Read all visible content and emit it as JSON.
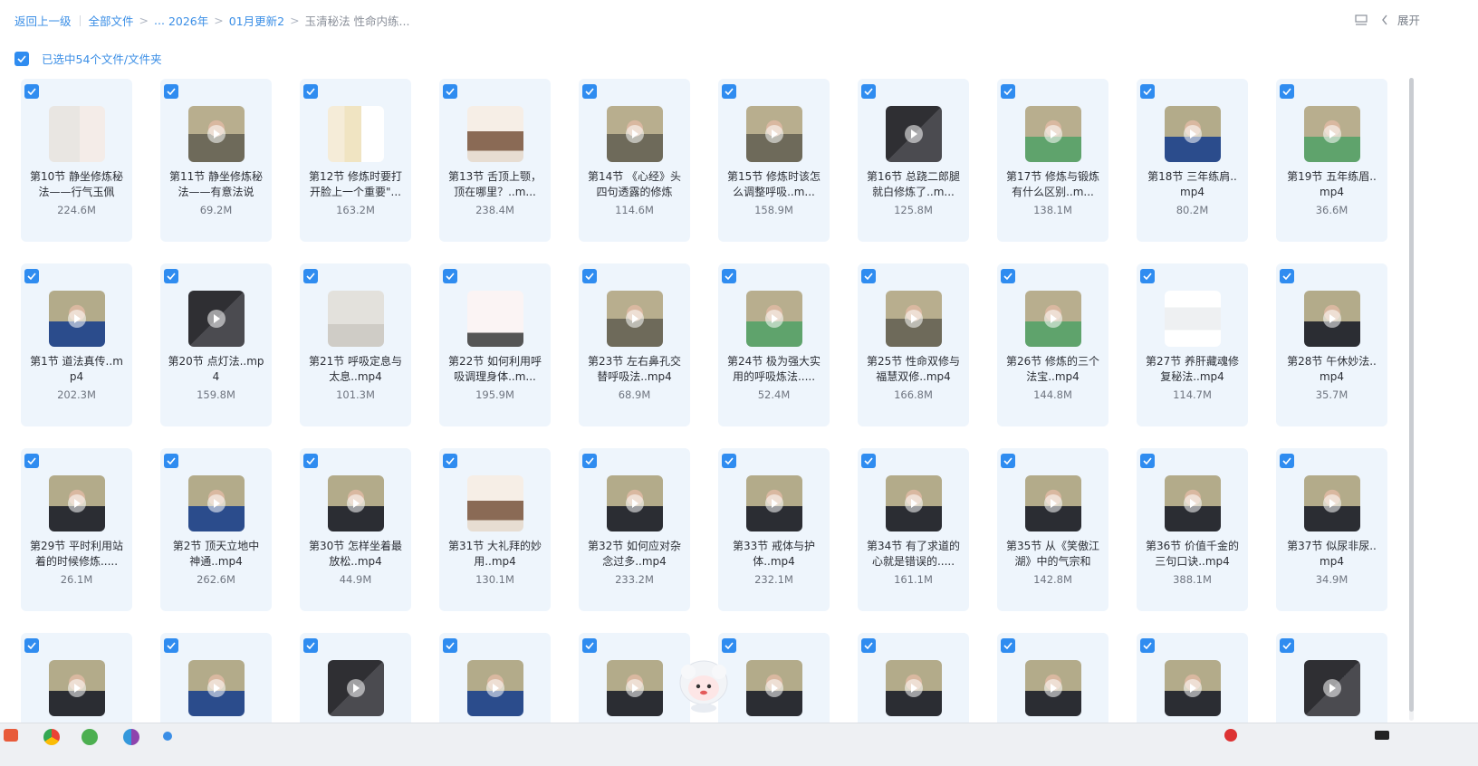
{
  "breadcrumb": {
    "back": "返回上一级",
    "all_files": "全部文件",
    "ellipsis": "...",
    "year": "2026年",
    "folder": "01月更新2",
    "current": "玉清秘法 性命内练..."
  },
  "header": {
    "expand_label": "展开"
  },
  "selection": {
    "label": "已选中54个文件/文件夹"
  },
  "files": [
    {
      "name": "第10节 静坐修炼秘法——行气玉佩",
      "size": "224.6M",
      "thumb": "doc-light"
    },
    {
      "name": "第11节 静坐修炼秘法——有意法说",
      "size": "69.2M",
      "thumb": "video-man-light"
    },
    {
      "name": "第12节 修炼时要打开脸上一个重要\"...",
      "size": "163.2M",
      "thumb": "doc-yellow"
    },
    {
      "name": "第13节 舌顶上颚，顶在哪里？..m...",
      "size": "238.4M",
      "thumb": "doc-room"
    },
    {
      "name": "第14节 《心经》头四句透露的修炼",
      "size": "114.6M",
      "thumb": "video-man-light"
    },
    {
      "name": "第15节 修炼时该怎么调整呼吸..m...",
      "size": "158.9M",
      "thumb": "video-man-light"
    },
    {
      "name": "第16节 总跷二郎腿就白修炼了..m...",
      "size": "125.8M",
      "thumb": "doc-dark"
    },
    {
      "name": "第17节 修炼与锻炼有什么区别..m...",
      "size": "138.1M",
      "thumb": "video-man-green"
    },
    {
      "name": "第18节 三年练肩..mp4",
      "size": "80.2M",
      "thumb": "video-man-blue"
    },
    {
      "name": "第19节 五年练眉..mp4",
      "size": "36.6M",
      "thumb": "video-man-green"
    },
    {
      "name": "第1节 道法真传..mp4",
      "size": "202.3M",
      "thumb": "video-man-blue"
    },
    {
      "name": "第20节 点灯法..mp4",
      "size": "159.8M",
      "thumb": "doc-dark"
    },
    {
      "name": "第21节 呼吸定息与太息..mp4",
      "size": "101.3M",
      "thumb": "doc-gray"
    },
    {
      "name": "第22节 如何利用呼吸调理身体..m...",
      "size": "195.9M",
      "thumb": "doc-chart"
    },
    {
      "name": "第23节 左右鼻孔交替呼吸法..mp4",
      "size": "68.9M",
      "thumb": "video-man-light"
    },
    {
      "name": "第24节 极为强大实用的呼吸炼法.....",
      "size": "52.4M",
      "thumb": "video-man-green"
    },
    {
      "name": "第25节 性命双修与福慧双修..mp4",
      "size": "166.8M",
      "thumb": "video-man-light"
    },
    {
      "name": "第26节 修炼的三个法宝..mp4",
      "size": "144.8M",
      "thumb": "video-man-green"
    },
    {
      "name": "第27节 养肝藏魂修复秘法..mp4",
      "size": "114.7M",
      "thumb": "doc-white"
    },
    {
      "name": "第28节 午休妙法..mp4",
      "size": "35.7M",
      "thumb": "video-man-dark"
    },
    {
      "name": "第29节 平时利用站着的时候修炼.....",
      "size": "26.1M",
      "thumb": "video-man-dark"
    },
    {
      "name": "第2节 顶天立地中神通..mp4",
      "size": "262.6M",
      "thumb": "video-man-blue"
    },
    {
      "name": "第30节 怎样坐着最放松..mp4",
      "size": "44.9M",
      "thumb": "video-man-dark"
    },
    {
      "name": "第31节 大礼拜的妙用..mp4",
      "size": "130.1M",
      "thumb": "doc-room"
    },
    {
      "name": "第32节 如何应对杂念过多..mp4",
      "size": "233.2M",
      "thumb": "video-man-dark"
    },
    {
      "name": "第33节 戒体与护体..mp4",
      "size": "232.1M",
      "thumb": "video-man-dark"
    },
    {
      "name": "第34节 有了求道的心就是错误的.....",
      "size": "161.1M",
      "thumb": "video-man-dark"
    },
    {
      "name": "第35节 从《笑傲江湖》中的气宗和",
      "size": "142.8M",
      "thumb": "video-man-dark"
    },
    {
      "name": "第36节 价值千金的三句口诀..mp4",
      "size": "388.1M",
      "thumb": "video-man-dark"
    },
    {
      "name": "第37节 似尿非尿..mp4",
      "size": "34.9M",
      "thumb": "video-man-dark"
    },
    {
      "name": "",
      "size": "",
      "thumb": "video-man-dark"
    },
    {
      "name": "",
      "size": "",
      "thumb": "video-man-blue"
    },
    {
      "name": "",
      "size": "",
      "thumb": "doc-dark"
    },
    {
      "name": "",
      "size": "",
      "thumb": "video-man-blue"
    },
    {
      "name": "",
      "size": "",
      "thumb": "video-man-dark"
    },
    {
      "name": "",
      "size": "",
      "thumb": "video-man-dark"
    },
    {
      "name": "",
      "size": "",
      "thumb": "video-man-dark"
    },
    {
      "name": "",
      "size": "",
      "thumb": "video-man-dark"
    },
    {
      "name": "",
      "size": "",
      "thumb": "video-man-dark"
    },
    {
      "name": "",
      "size": "",
      "thumb": "doc-dark"
    }
  ],
  "colors": {
    "accent": "#2f8cf0",
    "card_bg": "#eef5fc",
    "link": "#3a8ee6"
  },
  "icons": {
    "check": "checkmark-icon",
    "play": "play-icon",
    "layout": "layout-toggle-icon",
    "chevron": "chevron-left-icon"
  }
}
